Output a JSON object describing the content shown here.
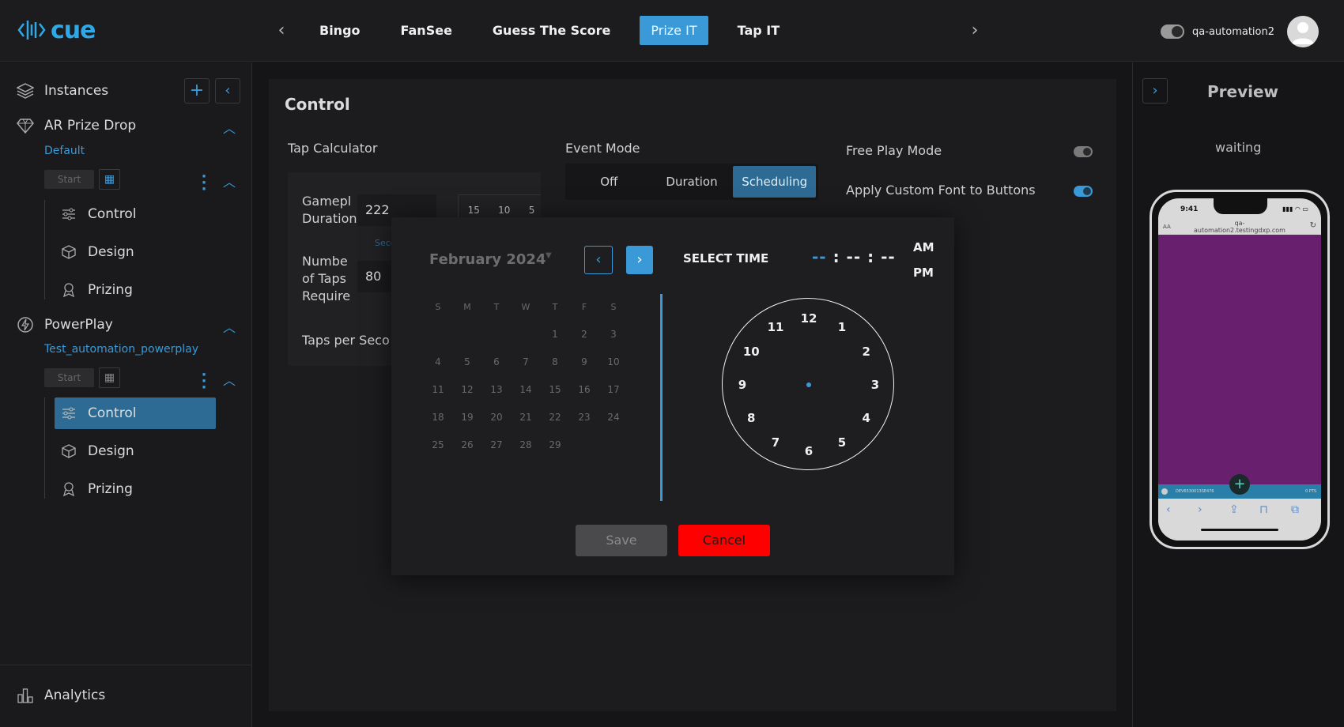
{
  "header": {
    "logo_text": "cue",
    "tabs": [
      "Bingo",
      "FanSee",
      "Guess The Score",
      "Prize IT",
      "Tap IT"
    ],
    "active_tab": "Prize IT",
    "username": "qa-automation2"
  },
  "sidebar": {
    "instances_label": "Instances",
    "groups": [
      {
        "name": "AR Prize Drop",
        "instance": "Default",
        "start_label": "Start",
        "items": [
          "Control",
          "Design",
          "Prizing"
        ]
      },
      {
        "name": "PowerPlay",
        "instance": "Test_automation_powerplay",
        "start_label": "Start",
        "items": [
          "Control",
          "Design",
          "Prizing"
        ],
        "active_item": "Control"
      }
    ],
    "analytics_label": "Analytics"
  },
  "main": {
    "title": "Control",
    "tap_calculator_label": "Tap Calculator",
    "calculator": {
      "gameplay_label_1": "Gamepl",
      "gameplay_label_2": "Duration",
      "gameplay_value": "222",
      "seconds_label": "Seconds",
      "presets": [
        "15",
        "10",
        "5"
      ],
      "taps_label_1": "Numbe",
      "taps_label_2": "of Taps",
      "taps_label_3": "Require",
      "taps_value": "80",
      "tps_label": "Taps per Seco"
    },
    "event_mode_label": "Event Mode",
    "event_modes": [
      "Off",
      "Duration",
      "Scheduling"
    ],
    "event_mode_selected": "Scheduling",
    "free_play_label": "Free Play Mode",
    "free_play_on": false,
    "custom_font_label": "Apply Custom Font to Buttons",
    "custom_font_on": true
  },
  "modal": {
    "month_label": "February 2024",
    "weekdays": [
      "S",
      "M",
      "T",
      "W",
      "T",
      "F",
      "S"
    ],
    "days": [
      [
        "",
        "",
        "",
        "",
        "1",
        "2",
        "3"
      ],
      [
        "4",
        "5",
        "6",
        "7",
        "8",
        "9",
        "10"
      ],
      [
        "11",
        "12",
        "13",
        "14",
        "15",
        "16",
        "17"
      ],
      [
        "18",
        "19",
        "20",
        "21",
        "22",
        "23",
        "24"
      ],
      [
        "25",
        "26",
        "27",
        "28",
        "29",
        "",
        ""
      ]
    ],
    "select_time_label": "SELECT TIME",
    "time_hh": "--",
    "time_mm": "--",
    "time_ss": "--",
    "am_label": "AM",
    "pm_label": "PM",
    "clock_numbers": [
      "12",
      "1",
      "2",
      "3",
      "4",
      "5",
      "6",
      "7",
      "8",
      "9",
      "10",
      "11"
    ],
    "save_label": "Save",
    "cancel_label": "Cancel"
  },
  "preview": {
    "title": "Preview",
    "status": "waiting",
    "phone_time": "9:41",
    "url_line1": "qa-",
    "url_line2": "automation2.testingdxp.com",
    "url_aa": "AA",
    "bar_left": "DEV6530013SE476",
    "bar_right": "0 PTS"
  },
  "colors": {
    "accent": "#3a9ad8",
    "active_bg": "#2d6b94",
    "cancel": "#ff0000",
    "phone_content": "#68206e"
  }
}
